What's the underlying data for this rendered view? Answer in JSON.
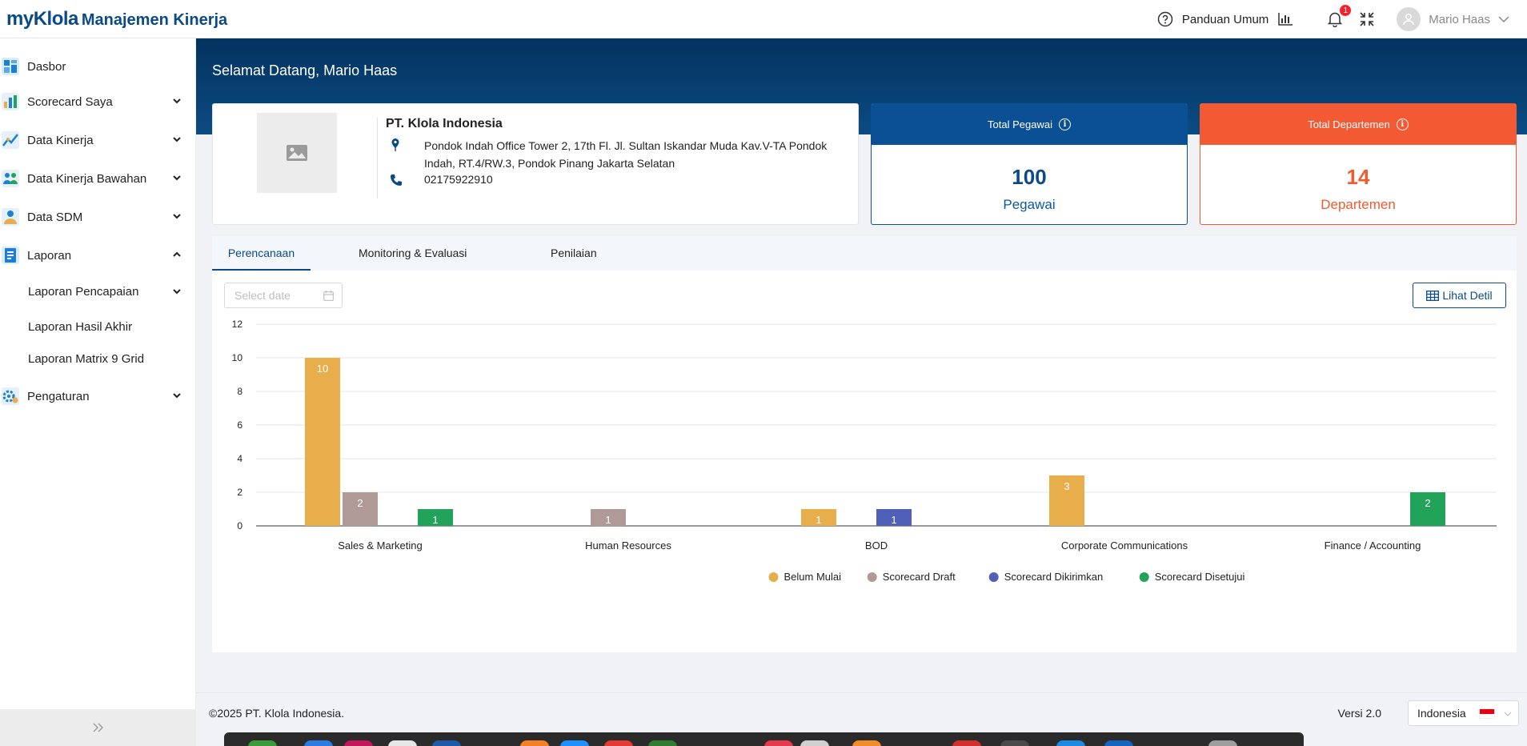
{
  "app": {
    "brand_prefix": "myKlola",
    "brand_product": "Manajemen Kinerja"
  },
  "topbar": {
    "guide_label": "Panduan Umum",
    "notification_count": "1",
    "user_name": "Mario Haas"
  },
  "sidebar": {
    "items": [
      {
        "label": "Dasbor",
        "icon": "dashboard-icon"
      },
      {
        "label": "Scorecard Saya",
        "icon": "scorecard-icon",
        "chevron": "down"
      },
      {
        "label": "Data Kinerja",
        "icon": "performance-data-icon",
        "chevron": "down"
      },
      {
        "label": "Data Kinerja Bawahan",
        "icon": "team-performance-icon",
        "chevron": "down"
      },
      {
        "label": "Data SDM",
        "icon": "hr-data-icon",
        "chevron": "down"
      },
      {
        "label": "Laporan",
        "icon": "report-icon",
        "chevron": "up"
      },
      {
        "label": "Pengaturan",
        "icon": "settings-icon",
        "chevron": "down"
      }
    ],
    "sub_items": [
      {
        "label": "Laporan Pencapaian",
        "chevron": "down"
      },
      {
        "label": "Laporan Hasil Akhir"
      },
      {
        "label": "Laporan Matrix 9 Grid"
      }
    ]
  },
  "main": {
    "welcome": "Selamat Datang, Mario Haas",
    "company": {
      "name": "PT. Klola Indonesia",
      "address": "Pondok Indah Office Tower 2, 17th Fl. Jl. Sultan Iskandar Muda Kav.V-TA Pondok Indah, RT.4/RW.3, Pondok Pinang Jakarta Selatan",
      "phone": "02175922910"
    },
    "stats": [
      {
        "title": "Total Pegawai",
        "value": "100",
        "unit": "Pegawai",
        "color": "#0b4a86",
        "header_color": "#0b4f94"
      },
      {
        "title": "Total Departemen",
        "value": "14",
        "unit": "Departemen",
        "color": "#f05a30",
        "header_color": "#f35a34"
      }
    ],
    "tabs": [
      "Perencanaan",
      "Monitoring & Evaluasi",
      "Penilaian"
    ],
    "active_tab": "Perencanaan",
    "date_placeholder": "Select date",
    "detail_button": "Lihat Detil"
  },
  "chart_data": {
    "type": "bar",
    "categories": [
      "Sales & Marketing",
      "Human Resources",
      "BOD",
      "Corporate Communications",
      "Finance / Accounting"
    ],
    "series": [
      {
        "name": "Belum Mulai",
        "color": "#e8ae4c",
        "values": [
          10,
          0,
          1,
          3,
          0
        ]
      },
      {
        "name": "Scorecard Draft",
        "color": "#b09a98",
        "values": [
          2,
          1,
          0,
          0,
          0
        ]
      },
      {
        "name": "Scorecard Dikirimkan",
        "color": "#5060b8",
        "values": [
          0,
          0,
          1,
          0,
          0
        ]
      },
      {
        "name": "Scorecard Disetujui",
        "color": "#22a35a",
        "values": [
          1,
          0,
          0,
          0,
          2
        ]
      }
    ],
    "yticks": [
      "0",
      "2",
      "4",
      "6",
      "8",
      "10",
      "12"
    ],
    "ylim": [
      0,
      12
    ],
    "grid": true,
    "legend_position": "bottom"
  },
  "footer": {
    "copyright": "©2025 PT. Klola Indonesia.",
    "version": "Versi 2.0",
    "language": "Indonesia"
  }
}
